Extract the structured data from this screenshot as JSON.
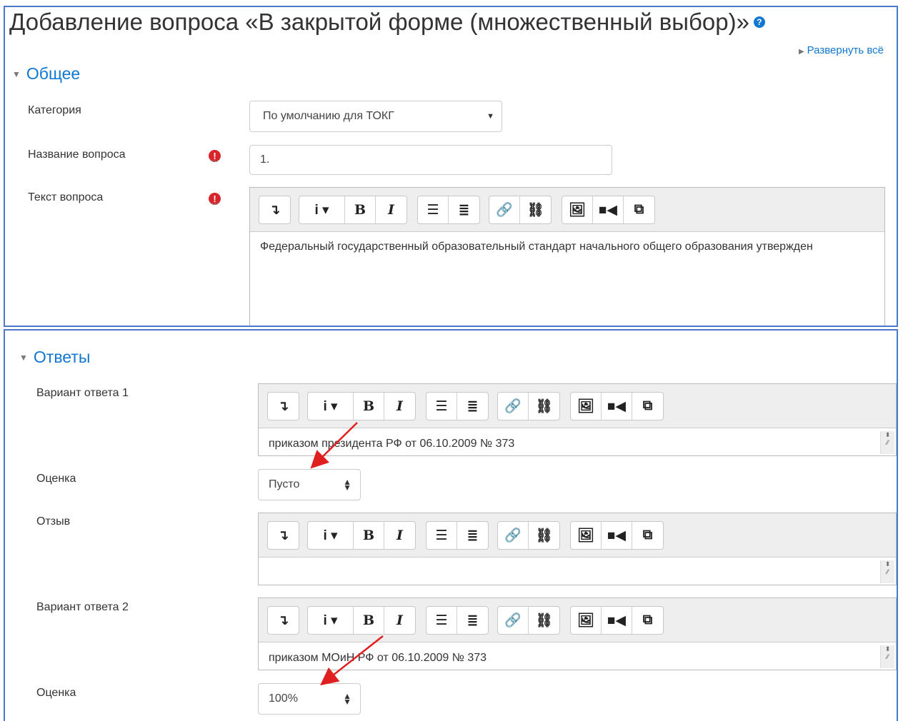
{
  "header": {
    "title": "Добавление вопроса «В закрытой форме (множественный выбор)»",
    "help_icon": "?",
    "expand_all": "Развернуть всё"
  },
  "general": {
    "section_title": "Общее",
    "category_label": "Категория",
    "category_value": "По умолчанию для ТОКГ",
    "name_label": "Название вопроса",
    "name_value": "1.",
    "text_label": "Текст вопроса",
    "text_value": "Федеральный государственный образовательный стандарт начального общего образования утвержден",
    "required_icon": "!"
  },
  "toolbar": {
    "expand_icon": "↴",
    "info_icon": "i ▾",
    "bold": "B",
    "italic": "I",
    "bullet_list_icon": "☰",
    "numbered_list_icon": "≣",
    "link_icon": "🔗",
    "unlink_icon": "⛓",
    "image_icon": "🖼",
    "video_icon": "■◀",
    "copy_icon": "⧉"
  },
  "answers": {
    "section_title": "Ответы",
    "answer1_label": "Вариант ответа 1",
    "answer1_value": "приказом президента РФ от 06.10.2009 № 373",
    "grade1_label": "Оценка",
    "grade1_value": "Пусто",
    "feedback_label": "Отзыв",
    "feedback_value": "",
    "answer2_label": "Вариант ответа 2",
    "answer2_value": "приказом МОиН РФ от 06.10.2009 № 373",
    "grade2_label": "Оценка",
    "grade2_value": "100%"
  },
  "colors": {
    "accent": "#1177d1",
    "border": "#4a79c9",
    "required": "#d9252a",
    "arrow": "#e02020"
  }
}
